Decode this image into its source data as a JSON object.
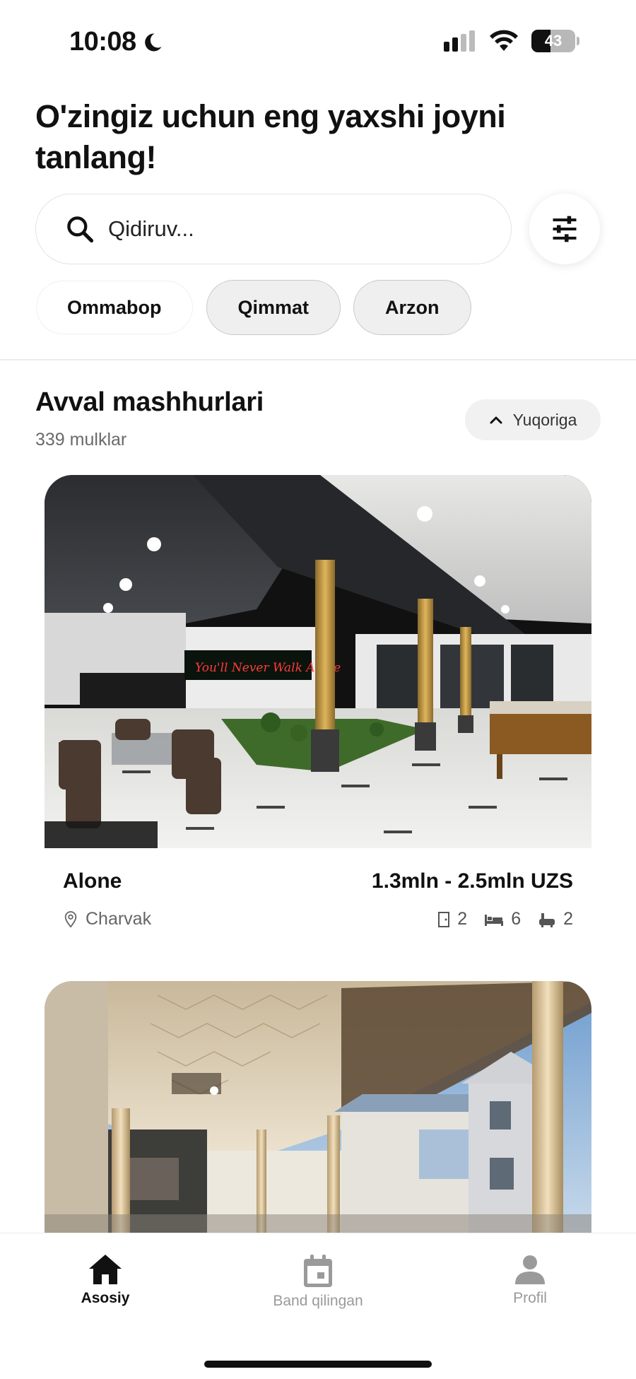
{
  "status_bar": {
    "time": "10:08",
    "battery": "43",
    "battery_level_percent": 43
  },
  "headline": "O'zingiz uchun eng yaxshi joyni tanlang!",
  "search": {
    "placeholder": "Qidiruv...",
    "value": ""
  },
  "chips": [
    {
      "label": "Ommabop",
      "selected": true
    },
    {
      "label": "Qimmat",
      "selected": false
    },
    {
      "label": "Arzon",
      "selected": false
    }
  ],
  "section": {
    "title": "Avval mashhurlari",
    "count": "339 mulklar",
    "up_button_label": "Yuqoriga"
  },
  "listings": [
    {
      "name": "Alone",
      "price": "1.3mln - 2.5mln UZS",
      "location": "Charvak",
      "rooms": "2",
      "beds": "6",
      "baths": "2",
      "sign_text": "You'll Never Walk Alone"
    },
    {
      "name": "",
      "price": "",
      "location": ""
    }
  ],
  "tabs": [
    {
      "label": "Asosiy",
      "icon": "home-icon",
      "active": true
    },
    {
      "label": "Band qilingan",
      "icon": "calendar-icon",
      "active": false
    },
    {
      "label": "Profil",
      "icon": "person-icon",
      "active": false
    }
  ],
  "colors": {
    "accent": "#111111",
    "inactive": "#9a9a9a",
    "chip_bg": "#efefef"
  }
}
